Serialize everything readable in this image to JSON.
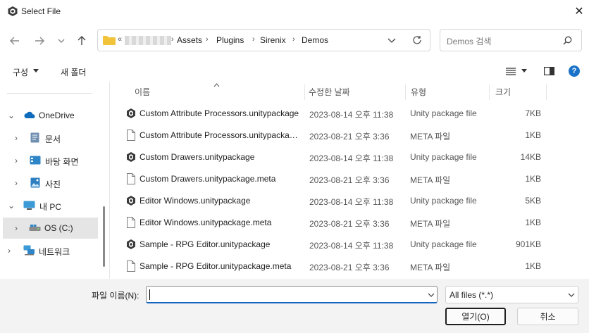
{
  "window": {
    "title": "Select File"
  },
  "nav": {
    "breadcrumb": [
      "Assets",
      "Plugins",
      "Sirenix",
      "Demos"
    ],
    "search_placeholder": "Demos 검색"
  },
  "toolbar": {
    "organize": "구성",
    "new_folder": "새 폴더"
  },
  "sidebar": {
    "items": [
      {
        "label": "OneDrive"
      },
      {
        "label": "문서"
      },
      {
        "label": "바탕 화면"
      },
      {
        "label": "사진"
      },
      {
        "label": "내 PC"
      },
      {
        "label": "OS (C:)"
      },
      {
        "label": "네트워크"
      }
    ]
  },
  "columns": {
    "name": "이름",
    "date": "수정한 날짜",
    "type": "유형",
    "size": "크기"
  },
  "files": [
    {
      "name": "Custom Attribute Processors.unitypackage",
      "date": "2023-08-14 오후 11:38",
      "type": "Unity package file",
      "size": "7KB",
      "icon": "unity-icon"
    },
    {
      "name": "Custom Attribute Processors.unitypackage.meta",
      "date": "2023-08-21 오후 3:36",
      "type": "META 파일",
      "size": "1KB",
      "icon": "document-icon"
    },
    {
      "name": "Custom Drawers.unitypackage",
      "date": "2023-08-14 오후 11:38",
      "type": "Unity package file",
      "size": "14KB",
      "icon": "unity-icon"
    },
    {
      "name": "Custom Drawers.unitypackage.meta",
      "date": "2023-08-21 오후 3:36",
      "type": "META 파일",
      "size": "1KB",
      "icon": "document-icon"
    },
    {
      "name": "Editor Windows.unitypackage",
      "date": "2023-08-14 오후 11:38",
      "type": "Unity package file",
      "size": "5KB",
      "icon": "unity-icon"
    },
    {
      "name": "Editor Windows.unitypackage.meta",
      "date": "2023-08-21 오후 3:36",
      "type": "META 파일",
      "size": "1KB",
      "icon": "document-icon"
    },
    {
      "name": "Sample - RPG Editor.unitypackage",
      "date": "2023-08-14 오후 11:38",
      "type": "Unity package file",
      "size": "901KB",
      "icon": "unity-icon"
    },
    {
      "name": "Sample - RPG Editor.unitypackage.meta",
      "date": "2023-08-21 오후 3:36",
      "type": "META 파일",
      "size": "1KB",
      "icon": "document-icon"
    }
  ],
  "footer": {
    "filename_label": "파일 이름(N):",
    "filename_value": "",
    "filter_value": "All files (*.*)",
    "open_label": "열기(O)",
    "cancel_label": "취소"
  },
  "colors": {
    "accent": "#1464c0",
    "folder": "#f1c33b",
    "onedrive": "#0f6cbd"
  }
}
